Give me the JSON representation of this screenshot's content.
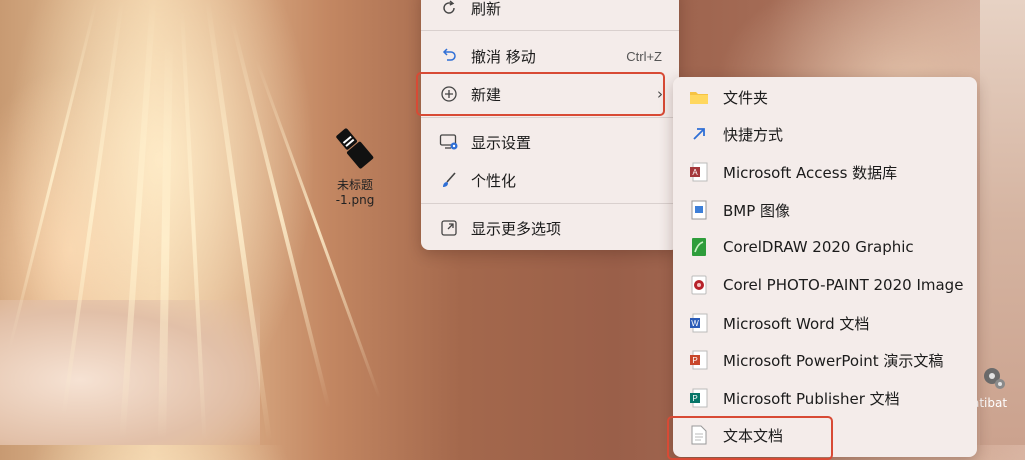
{
  "desktop": {
    "file_icon_label_line1": "未标题",
    "file_icon_label_line2": "-1.png",
    "partial_icon_label": "atibat"
  },
  "context_menu": {
    "items": [
      {
        "label": "刷新",
        "icon": "refresh-icon"
      },
      {
        "label": "撤消 移动",
        "shortcut": "Ctrl+Z",
        "icon": "undo-icon"
      },
      {
        "label": "新建",
        "icon": "new-plus-icon",
        "has_submenu": true,
        "highlighted": true
      },
      {
        "label": "显示设置",
        "icon": "display-settings-icon"
      },
      {
        "label": "个性化",
        "icon": "personalize-brush-icon"
      },
      {
        "label": "显示更多选项",
        "icon": "more-options-icon"
      }
    ]
  },
  "new_submenu": {
    "items": [
      {
        "label": "文件夹",
        "icon": "folder-icon"
      },
      {
        "label": "快捷方式",
        "icon": "shortcut-icon"
      },
      {
        "label": "Microsoft Access 数据库",
        "icon": "access-icon"
      },
      {
        "label": "BMP 图像",
        "icon": "bmp-icon"
      },
      {
        "label": "CorelDRAW 2020 Graphic",
        "icon": "coreldraw-icon"
      },
      {
        "label": "Corel PHOTO-PAINT 2020 Image",
        "icon": "photopaint-icon"
      },
      {
        "label": "Microsoft Word 文档",
        "icon": "word-icon"
      },
      {
        "label": "Microsoft PowerPoint 演示文稿",
        "icon": "powerpoint-icon"
      },
      {
        "label": "Microsoft Publisher 文档",
        "icon": "publisher-icon"
      },
      {
        "label": "文本文档",
        "icon": "text-document-icon",
        "highlighted": true
      }
    ]
  },
  "colors": {
    "highlight_border": "#d84a35",
    "menu_bg": "#f4ecea"
  }
}
